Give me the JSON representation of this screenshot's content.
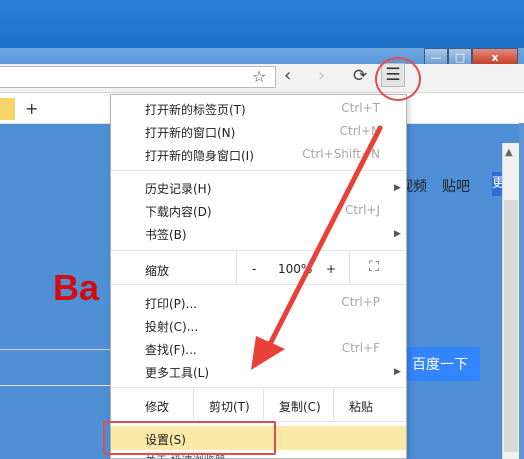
{
  "window": {
    "close_label": "x",
    "min_label": "—",
    "max_label": "□"
  },
  "toolbar": {
    "star_icon": "☆",
    "back_icon": "‹",
    "forward_icon": "›",
    "reload_icon": "⟳",
    "menu_icon": "☰"
  },
  "tabs": {
    "new_tab": "+"
  },
  "page": {
    "link_video": "视频",
    "link_tieba": "贴吧",
    "more_label": "更",
    "logo_text": "Ba",
    "search_button": "百度一下"
  },
  "menu": {
    "new_tab": "打开新的标签页(T)",
    "new_tab_sc": "Ctrl+T",
    "new_window": "打开新的窗口(N)",
    "new_window_sc": "Ctrl+N",
    "incognito": "打开新的隐身窗口(I)",
    "incognito_sc": "Ctrl+Shift+N",
    "history": "历史记录(H)",
    "downloads": "下载内容(D)",
    "downloads_sc": "Ctrl+J",
    "bookmarks": "书签(B)",
    "zoom": "缩放",
    "zoom_minus": "-",
    "zoom_value": "100%",
    "zoom_plus": "+",
    "fullscreen_icon": "⛶",
    "print": "打印(P)...",
    "print_sc": "Ctrl+P",
    "cast": "投射(C)...",
    "find": "查找(F)...",
    "find_sc": "Ctrl+F",
    "more_tools": "更多工具(L)",
    "edit": "修改",
    "cut": "剪切(T)",
    "copy": "复制(C)",
    "paste": "粘贴",
    "settings": "设置(S)",
    "about_partial": "关于 极速浏览器"
  },
  "colors": {
    "highlight": "#fbe9a8",
    "annotation_red": "#e04d4d",
    "arrow_red": "#e8403a",
    "baidu_blue": "#3385ff"
  }
}
